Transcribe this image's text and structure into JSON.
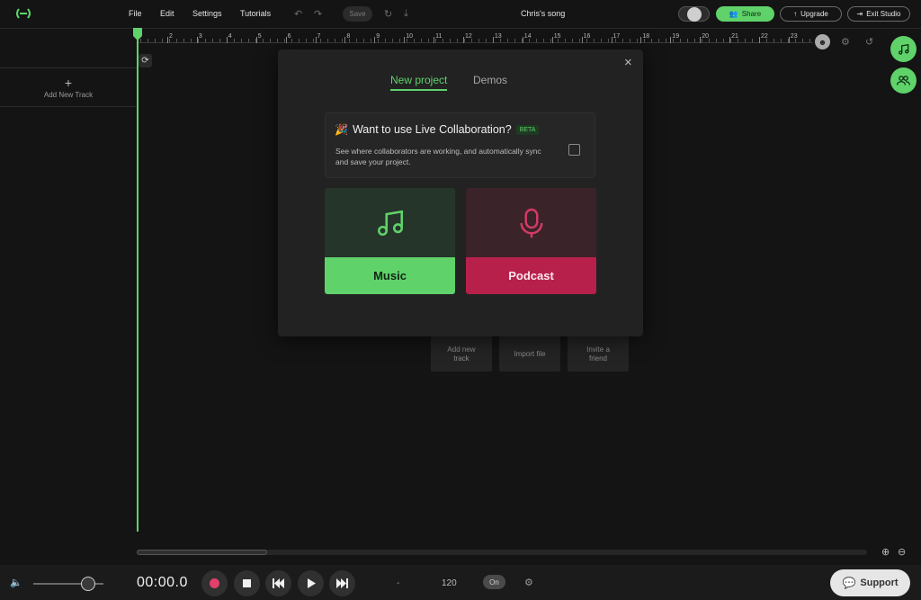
{
  "topbar": {
    "menu": [
      "File",
      "Edit",
      "Settings",
      "Tutorials"
    ],
    "save_label": "Save",
    "song_title": "Chris's song",
    "share_label": "Share",
    "upgrade_label": "Upgrade",
    "exit_label": "Exit Studio"
  },
  "ruler": {
    "ticks": [
      "2",
      "3",
      "4",
      "5",
      "6",
      "7",
      "8",
      "9",
      "10",
      "11",
      "12",
      "13",
      "14",
      "15",
      "16",
      "17",
      "18",
      "19",
      "20",
      "21",
      "22",
      "23"
    ]
  },
  "sidebar": {
    "add_track_label": "Add New Track"
  },
  "dialog": {
    "tabs": [
      {
        "label": "New project",
        "active": true
      },
      {
        "label": "Demos",
        "active": false
      }
    ],
    "collab": {
      "emoji": "🎉",
      "title": "Want to use Live Collaboration?",
      "badge": "BETA",
      "description": "See where collaborators are working, and automatically sync and save your project.",
      "checked": false
    },
    "cards": [
      {
        "label": "Music",
        "icon": "music-note-icon",
        "color": "#5fd26a"
      },
      {
        "label": "Podcast",
        "icon": "microphone-icon",
        "color": "#b8204c"
      }
    ]
  },
  "tiles": [
    {
      "label": "Add new track"
    },
    {
      "label": "Import file"
    },
    {
      "label": "Invite a friend"
    }
  ],
  "bottombar": {
    "time": "00:00.0",
    "key": "-",
    "tempo": "120",
    "metronome": "On",
    "support_label": "Support",
    "volume": 0.78
  },
  "colors": {
    "accent": "#5fd26a",
    "podcast": "#b8204c",
    "record": "#e0406a"
  }
}
